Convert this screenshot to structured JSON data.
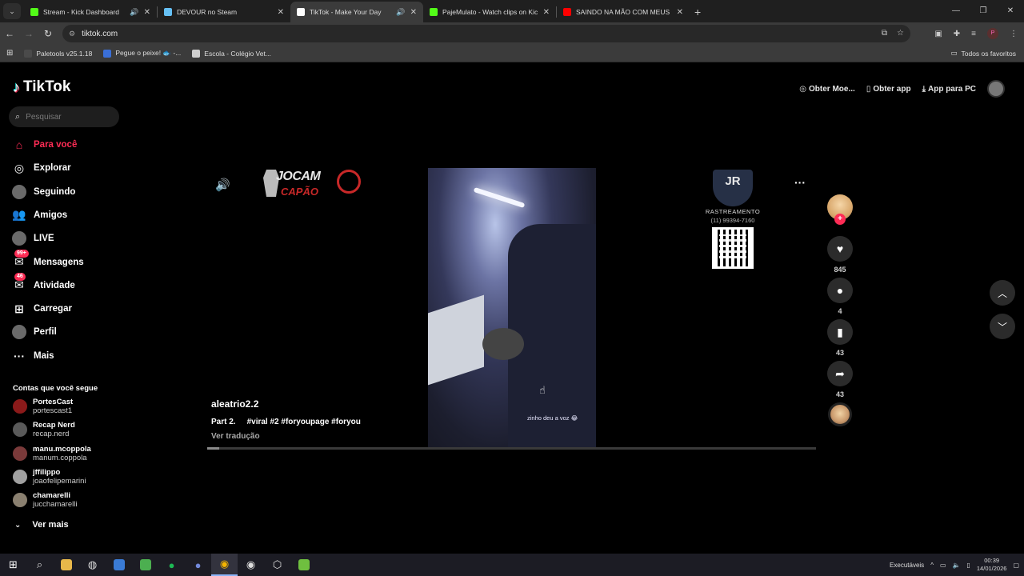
{
  "browser": {
    "tabs": [
      {
        "title": "Stream - Kick Dashboard",
        "fav_color": "#53fc18",
        "sound": true
      },
      {
        "title": "DEVOUR no Steam",
        "fav_color": "#66c0f4",
        "sound": false
      },
      {
        "title": "TikTok - Make Your Day",
        "fav_color": "#ffffff",
        "sound": true,
        "active": true
      },
      {
        "title": "PajeMulato - Watch clips on Kic",
        "fav_color": "#53fc18",
        "sound": false
      },
      {
        "title": "SAINDO NA MÃO COM MEUS",
        "fav_color": "#ff0000",
        "sound": false
      }
    ],
    "url": "tiktok.com",
    "bookmarks": [
      {
        "label": "Paletools v25.1.18",
        "color": "#4a4a4a"
      },
      {
        "label": "Pegue o peixe! 🐟 -...",
        "color": "#3a6fd8"
      },
      {
        "label": "Escola - Colégio Vet...",
        "color": "#cfcfcf"
      }
    ],
    "bookmarks_all": "Todos os favoritos",
    "profile_initial": "P"
  },
  "sidebar": {
    "brand": "TikTok",
    "search_placeholder": "Pesquisar",
    "nav": [
      {
        "label": "Para você",
        "icon": "home-icon",
        "active": true
      },
      {
        "label": "Explorar",
        "icon": "compass-icon"
      },
      {
        "label": "Seguindo",
        "icon": "following-avatar-icon"
      },
      {
        "label": "Amigos",
        "icon": "friends-icon"
      },
      {
        "label": "LIVE",
        "icon": "live-avatar-icon"
      },
      {
        "label": "Mensagens",
        "icon": "messages-icon",
        "badge": "99+"
      },
      {
        "label": "Atividade",
        "icon": "activity-icon",
        "badge": "46"
      },
      {
        "label": "Carregar",
        "icon": "upload-icon"
      },
      {
        "label": "Perfil",
        "icon": "profile-avatar-icon"
      },
      {
        "label": "Mais",
        "icon": "more-icon"
      }
    ],
    "following_title": "Contas que você segue",
    "following": [
      {
        "name": "PortesCast",
        "handle": "portescast1",
        "color": "#8b1a1a"
      },
      {
        "name": "Recap Nerd",
        "handle": "recap.nerd",
        "color": "#5a5a5a"
      },
      {
        "name": "manu.mcoppola",
        "handle": "manum.coppola",
        "color": "#7a3a3a"
      },
      {
        "name": "jffilippo",
        "handle": "joaofelipemarini",
        "color": "#a0a0a0"
      },
      {
        "name": "chamarelli",
        "handle": "jucchamarelli",
        "color": "#8a8070"
      }
    ],
    "see_more": "Ver mais"
  },
  "header": {
    "coins": "Obter Moe...",
    "get_app": "Obter app",
    "pc_app": "App para PC"
  },
  "video": {
    "overlay_left_line1": "JOCAM",
    "overlay_left_line2": "CAPÃO",
    "overlay_right_logo": "JR",
    "overlay_right_text": "RASTREAMENTO",
    "overlay_right_phone": "(11) 99394-7160",
    "in_video_caption": "zinho deu a voz 😂",
    "username": "aleatrio2.2",
    "description_part": "Part 2.",
    "hashtags": "#viral #2 #foryoupage #foryou",
    "translate": "Ver tradução",
    "progress": 0.02
  },
  "actions": {
    "likes": "845",
    "comments": "4",
    "saves": "43",
    "shares": "43"
  },
  "taskbar": {
    "tray_label": "Executáveis",
    "time": "00:39",
    "date": "14/01/2026"
  }
}
